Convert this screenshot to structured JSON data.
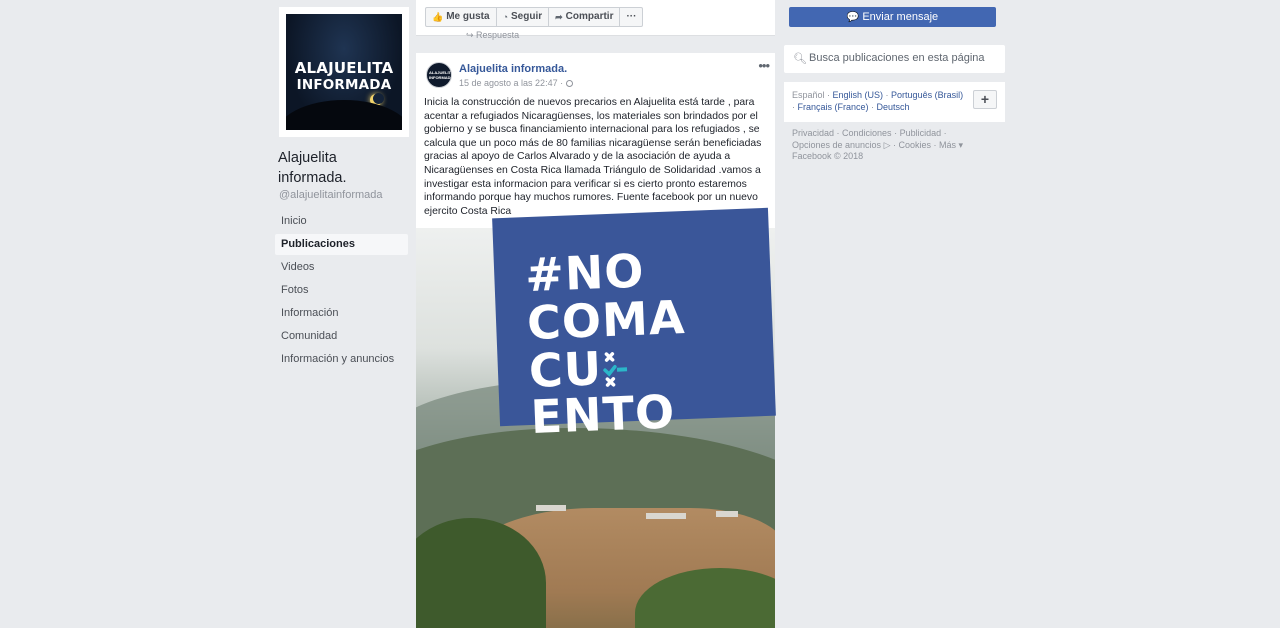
{
  "page": {
    "name": "Alajuelita informada.",
    "handle": "@alajuelitainformada",
    "logo_text": {
      "line1": "ALAJUELITA",
      "line2": "INFORMADA"
    }
  },
  "left_nav": [
    "Inicio",
    "Publicaciones",
    "Videos",
    "Fotos",
    "Información",
    "Comunidad",
    "Información y anuncios"
  ],
  "left_nav_active": "Publicaciones",
  "action_bar": {
    "like": "Me gusta",
    "follow": "Seguir",
    "share": "Compartir",
    "more": "···",
    "answer_fragment": "Respuesta"
  },
  "post": {
    "author": "Alajuelita informada.",
    "date": "15 de agosto a las 22:47 ·",
    "more": "•••",
    "avatar_text": "ALAJUELITA INFORMADA",
    "text": "Inicia la construcción de nuevos precarios en Alajuelita está tarde , para acentar a refugiados Nicaragüenses, los materiales son brindados por el gobierno y se busca financiamiento internacional para los refugiados , se calcula que un poco más de 80 familias nicaragüense serán beneficiadas gracias al apoyo de Carlos Alvarado y de la asociación de ayuda a Nicaragüenses en Costa Rica llamada Triángulo de Solidaridad .vamos a investigar esta informacion para verificar si es cierto pronto estaremos informando porque hay muchos rumores. Fuente facebook por un nuevo ejercito Costa Rica"
  },
  "overlay": {
    "line1": "#NO",
    "line2": "COMA",
    "line3_a": "CU",
    "line3_b": "ENTO",
    "colors": {
      "badge": "#3a5699",
      "check": "#2bb7c9"
    }
  },
  "right_col": {
    "send_message": "Enviar mensaje",
    "search_placeholder": "Busca publicaciones en esta página",
    "languages": [
      "Español",
      "English (US)",
      "Português (Brasil)",
      "Français (France)",
      "Deutsch"
    ],
    "add_language": "+",
    "footer_links": [
      "Privacidad",
      "Condiciones",
      "Publicidad",
      "Opciones de anuncios",
      "Cookies",
      "Más"
    ],
    "copyright": "Facebook © 2018"
  },
  "colors": {
    "background": "#e9ebee",
    "fb_blue": "#4267b2",
    "link": "#365899"
  }
}
